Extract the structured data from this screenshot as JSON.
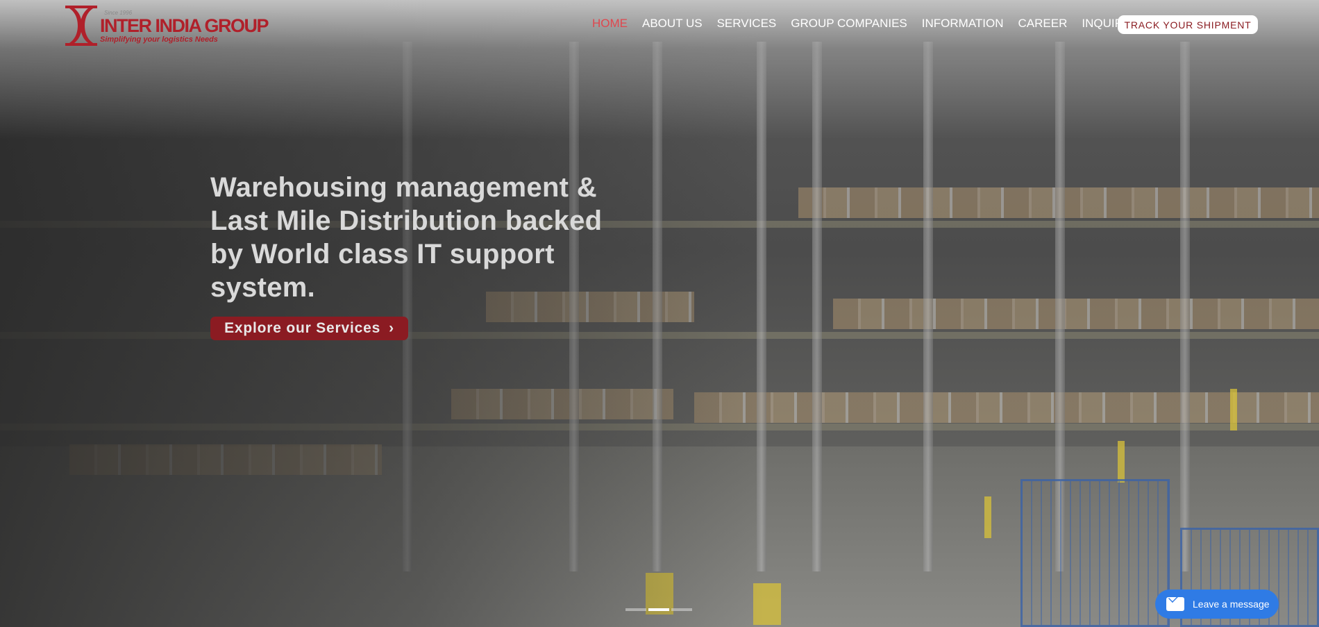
{
  "logo": {
    "since": "Since 1996",
    "name": "INTER INDIA GROUP",
    "tagline": "Simplifying your logistics Needs"
  },
  "nav": {
    "items": [
      {
        "label": "HOME",
        "active": true
      },
      {
        "label": "ABOUT US",
        "active": false
      },
      {
        "label": "SERVICES",
        "active": false
      },
      {
        "label": "GROUP COMPANIES",
        "active": false
      },
      {
        "label": "INFORMATION",
        "active": false
      },
      {
        "label": "CAREER",
        "active": false
      },
      {
        "label": "INQUIRY",
        "active": false
      }
    ],
    "track_label": "TRACK YOUR SHIPMENT"
  },
  "hero": {
    "headline": "Warehousing management & Last Mile Distribution backed by World class IT support system.",
    "cta_label": "Explore our Services",
    "cta_chevron": "›"
  },
  "slider": {
    "count": 3,
    "active_index": 1
  },
  "chat": {
    "label": "Leave a message",
    "icon": "envelope-icon"
  },
  "colors": {
    "brand_red": "#b0202a",
    "cta_red": "#8b1b22",
    "nav_active": "#e0474e",
    "chat_blue": "#2f7be5"
  }
}
